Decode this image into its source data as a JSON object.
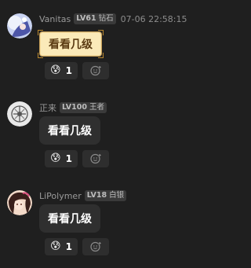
{
  "messages": [
    {
      "name": "Vanitas",
      "badge_level": "LV61",
      "badge_rank": "钻石",
      "time": "07-06 22:58:15",
      "text": "看看几级",
      "reaction_emoji": "😰",
      "reaction_count": "1",
      "avatar_icon": "anime-girl-avatar-icon"
    },
    {
      "name": "正来",
      "badge_level": "LV100",
      "badge_rank": "王者",
      "text": "看看几级",
      "reaction_emoji": "😰",
      "reaction_count": "1",
      "avatar_icon": "symbol-avatar-icon"
    },
    {
      "name": "LiPolymer",
      "badge_level": "LV18",
      "badge_rank": "白银",
      "text": "看看几级",
      "reaction_emoji": "😰",
      "reaction_count": "1",
      "avatar_icon": "anime-girl-avatar-icon"
    }
  ],
  "colors": {
    "background": "#1f1f1f",
    "bubble": "#2f2f2f",
    "gold_bubble": "#fbeab9",
    "badge": "#3a3a3a"
  }
}
